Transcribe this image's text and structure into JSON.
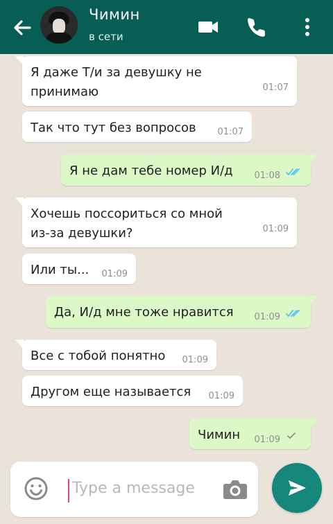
{
  "header": {
    "contact_name": "Чимин",
    "status": "в сети"
  },
  "messages": [
    {
      "direction": "incoming",
      "text": "Я даже Т/и за девушку не принимаю",
      "time": "01:07"
    },
    {
      "direction": "incoming",
      "text": "Так что тут без вопросов",
      "time": "01:07"
    },
    {
      "direction": "outgoing",
      "text": "Я не дам тебе номер И/д",
      "time": "01:08",
      "status": "read"
    },
    {
      "direction": "incoming",
      "text": "Хочешь поссориться  со мной из-за девушки?",
      "time": "01:09"
    },
    {
      "direction": "incoming",
      "text": "Или ты...",
      "time": "01:09"
    },
    {
      "direction": "outgoing",
      "text": "Да, И/д мне тоже нравится",
      "time": "01:09",
      "status": "read"
    },
    {
      "direction": "incoming",
      "text": "Все с тобой понятно",
      "time": "01:09"
    },
    {
      "direction": "incoming",
      "text": "Другом еще называется",
      "time": "01:09"
    },
    {
      "direction": "outgoing",
      "text": "Чимин",
      "time": "01:09",
      "status": "sent"
    }
  ],
  "composer": {
    "placeholder": "Type a message"
  },
  "colors": {
    "header": "#075e54",
    "incoming_bubble": "#ffffff",
    "outgoing_bubble": "#dcf8c6",
    "send_button": "#15877b",
    "read_ticks": "#4fc3f7"
  }
}
